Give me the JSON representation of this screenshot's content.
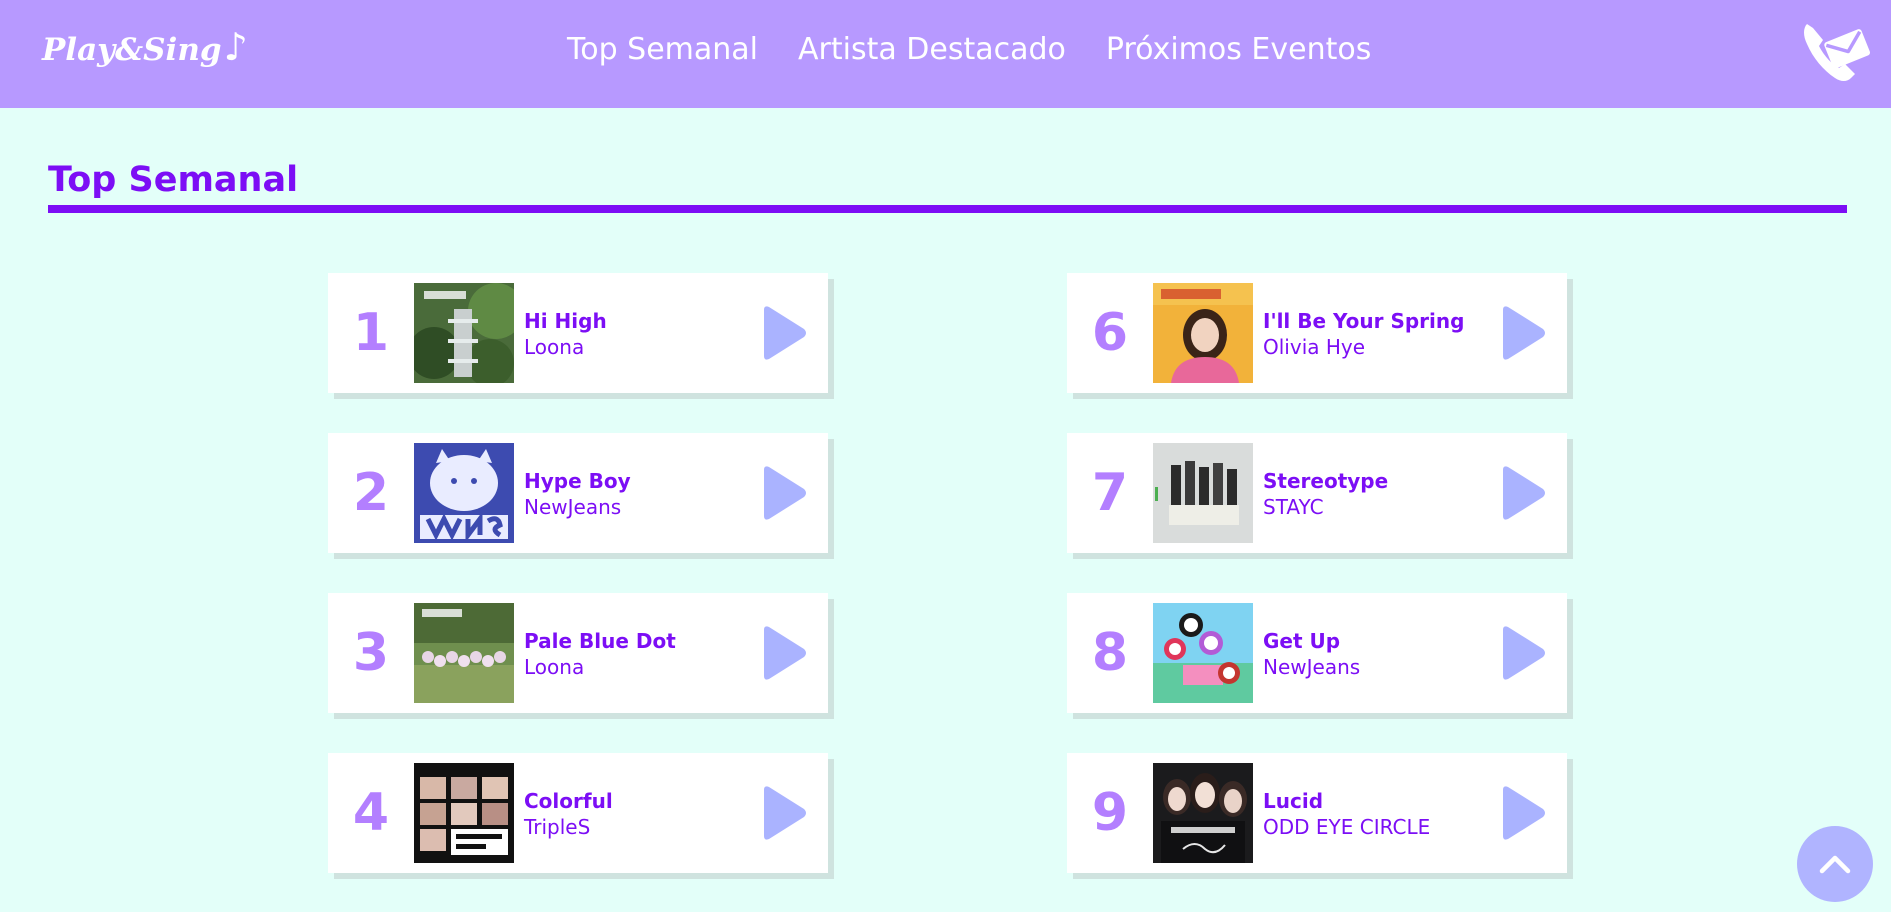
{
  "brand": {
    "name": "Play&Sing",
    "note": "♪"
  },
  "nav": {
    "links": [
      "Top Semanal",
      "Artista Destacado",
      "Próximos Eventos"
    ]
  },
  "section": {
    "title": "Top Semanal"
  },
  "songs": [
    {
      "rank": "1",
      "title": "Hi High",
      "artist": "Loona"
    },
    {
      "rank": "2",
      "title": "Hype Boy",
      "artist": "NewJeans"
    },
    {
      "rank": "3",
      "title": "Pale Blue Dot",
      "artist": "Loona"
    },
    {
      "rank": "4",
      "title": "Colorful",
      "artist": "TripleS"
    },
    {
      "rank": "6",
      "title": "I'll Be Your Spring",
      "artist": "Olivia Hye"
    },
    {
      "rank": "7",
      "title": "Stereotype",
      "artist": "STAYC"
    },
    {
      "rank": "8",
      "title": "Get Up",
      "artist": "NewJeans"
    },
    {
      "rank": "9",
      "title": "Lucid",
      "artist": "ODD EYE CIRCLE"
    }
  ],
  "icons": {
    "contact": "phone-mail-icon",
    "play": "play-icon",
    "scroll_top": "chevron-up-icon"
  },
  "colors": {
    "nav_bg": "#b799ff",
    "page_bg": "#e3fff9",
    "accent": "#7c0ef5",
    "rank": "#b37fff",
    "play": "#aab3ff",
    "card_shadow": "#cfe3df"
  }
}
